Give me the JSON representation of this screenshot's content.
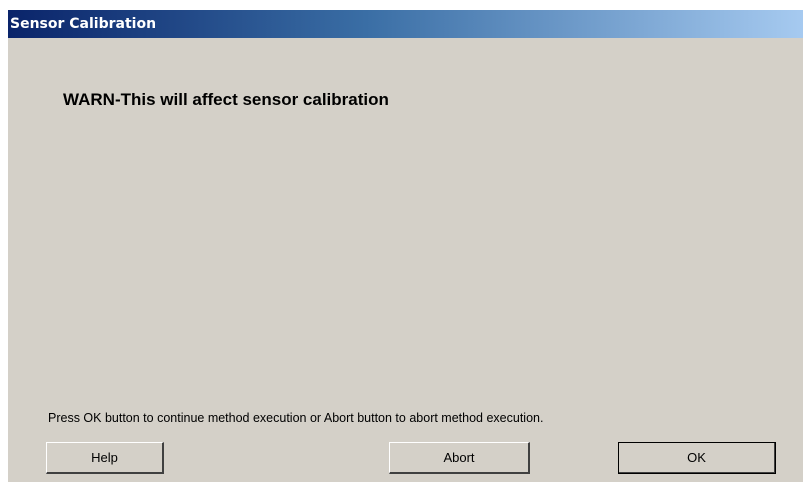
{
  "window": {
    "title": "Sensor Calibration"
  },
  "dialog": {
    "warning_text": "WARN-This will affect sensor calibration",
    "prompt_text": "Press OK button to continue method execution or Abort button to abort method execution."
  },
  "buttons": {
    "help_label": "Help",
    "abort_label": "Abort",
    "ok_label": "OK"
  },
  "colors": {
    "title_bar_start": "#0a246a",
    "title_bar_end": "#a6caf0",
    "dialog_background": "#d4d0c8"
  }
}
